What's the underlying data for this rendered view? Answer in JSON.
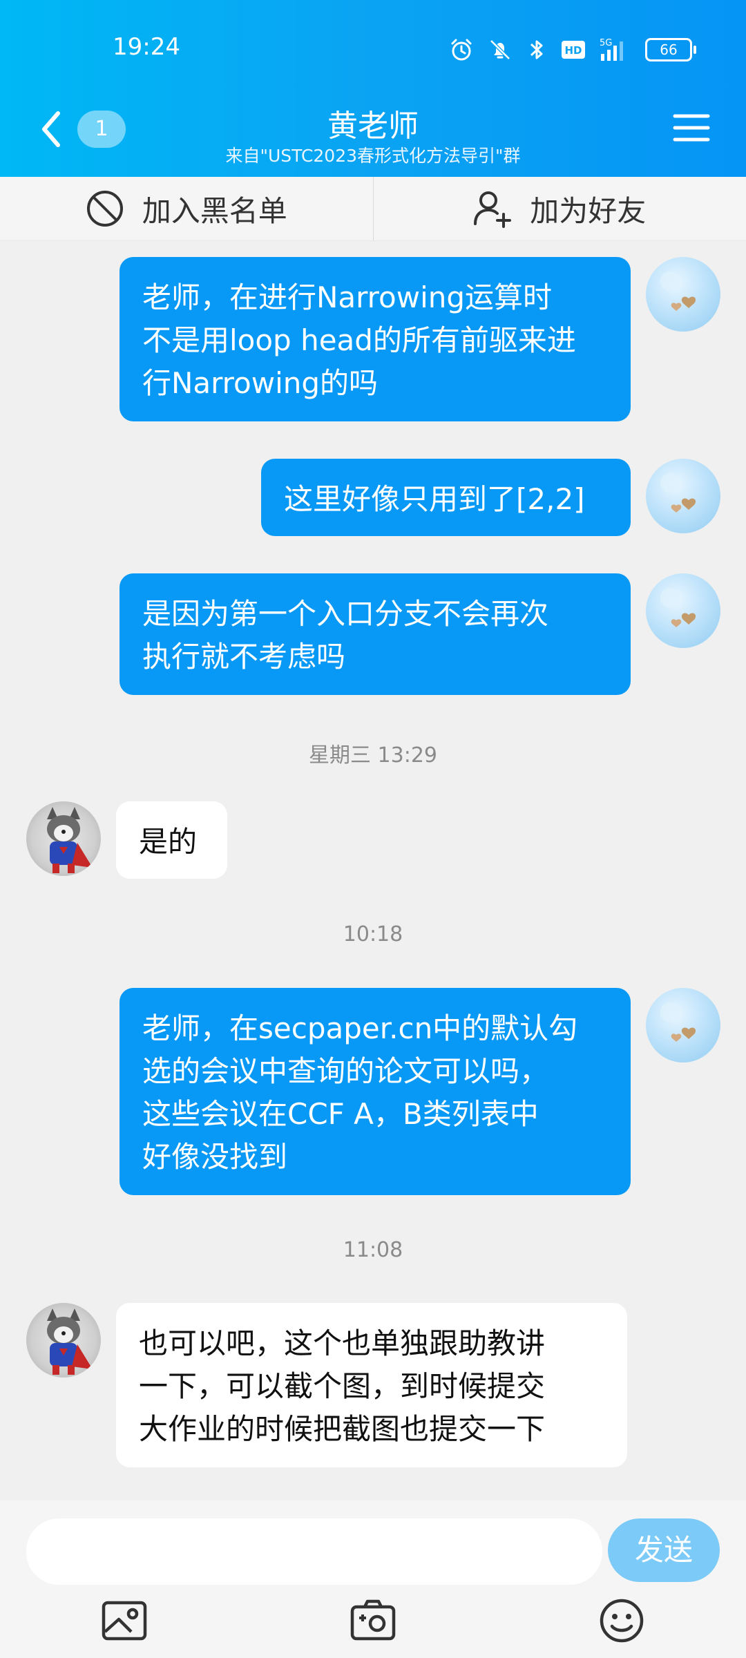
{
  "status_bar": {
    "time": "19:24",
    "battery": "66",
    "network": "5G",
    "hd": "HD"
  },
  "header": {
    "unread_count": "1",
    "title": "黄老师",
    "subtitle": "来自\"USTC2023春形式化方法导引\"群"
  },
  "actions": {
    "block_label": "加入黑名单",
    "add_friend_label": "加为好友"
  },
  "messages": [
    {
      "from": "self",
      "text": "老师，在进行Narrowing运算时\n不是用loop head的所有前驱来进\n行Narrowing的吗"
    },
    {
      "from": "self",
      "text": "这里好像只用到了[2,2]"
    },
    {
      "from": "self",
      "text": "是因为第一个入口分支不会再次\n执行就不考虑吗"
    },
    {
      "from": "teacher",
      "text": "是的"
    },
    {
      "from": "self",
      "text": "老师，在secpaper.cn中的默认勾\n选的会议中查询的论文可以吗，\n这些会议在CCF A，B类列表中\n好像没找到"
    },
    {
      "from": "teacher",
      "text": "也可以吧，这个也单独跟助教讲\n一下，可以截个图，到时候提交\n大作业的时候把截图也提交一下"
    }
  ],
  "timestamps": [
    "星期三 13:29",
    "10:18",
    "11:08"
  ],
  "input": {
    "value": "",
    "send_label": "发送"
  },
  "toolbar": {
    "icons": [
      "image-icon",
      "camera-icon",
      "emoji-icon"
    ]
  },
  "colors": {
    "header_blue": "#0aa3f3",
    "bubble_out": "#0899f7",
    "send_button": "#7ccaf7"
  }
}
